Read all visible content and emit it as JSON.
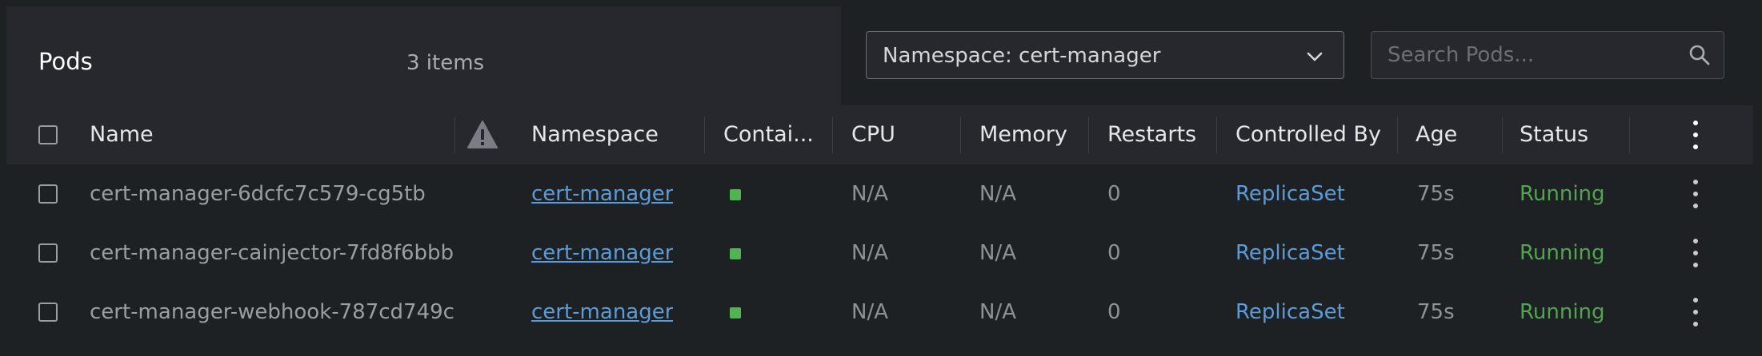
{
  "header": {
    "title": "Pods",
    "item_count": "3 items"
  },
  "toolbar": {
    "namespace_select": "Namespace: cert-manager",
    "search_placeholder": "Search Pods..."
  },
  "table": {
    "columns": {
      "name": "Name",
      "namespace": "Namespace",
      "containers": "Contai...",
      "cpu": "CPU",
      "memory": "Memory",
      "restarts": "Restarts",
      "controlled_by": "Controlled By",
      "age": "Age",
      "status": "Status"
    },
    "rows": [
      {
        "name": "cert-manager-6dcfc7c579-cg5tb",
        "namespace": "cert-manager",
        "cpu": "N/A",
        "memory": "N/A",
        "restarts": "0",
        "controlled_by": "ReplicaSet",
        "age": "75s",
        "status": "Running"
      },
      {
        "name": "cert-manager-cainjector-7fd8f6bbb",
        "namespace": "cert-manager",
        "cpu": "N/A",
        "memory": "N/A",
        "restarts": "0",
        "controlled_by": "ReplicaSet",
        "age": "75s",
        "status": "Running"
      },
      {
        "name": "cert-manager-webhook-787cd749c",
        "namespace": "cert-manager",
        "cpu": "N/A",
        "memory": "N/A",
        "restarts": "0",
        "controlled_by": "ReplicaSet",
        "age": "75s",
        "status": "Running"
      }
    ]
  },
  "colors": {
    "background": "#1e2124",
    "header_background": "#26282d",
    "link": "#5a9bd8",
    "status_running": "#52a352",
    "container_ready": "#52b352"
  },
  "icons": {
    "namespace_select": "chevron-down-icon",
    "search": "search-icon",
    "warning_column": "warning-icon",
    "row_menu": "kebab-menu-icon"
  }
}
